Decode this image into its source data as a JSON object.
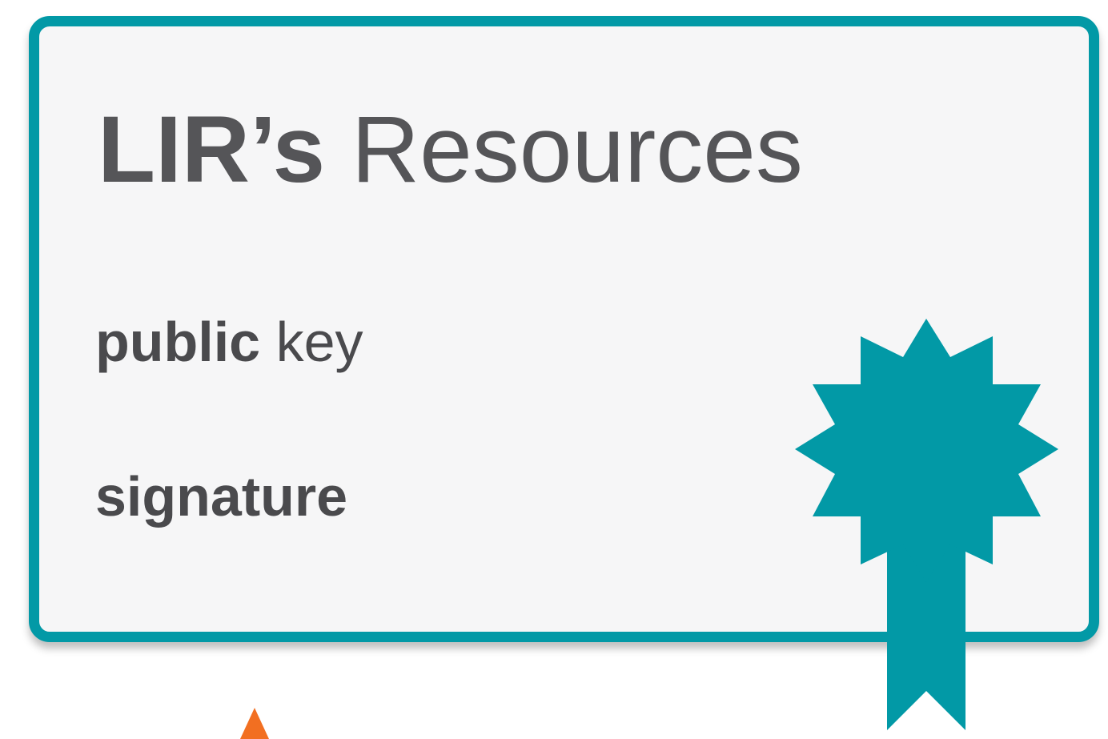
{
  "certificate": {
    "title_bold": "LIR’s",
    "title_regular": "Resources",
    "key_bold": "public",
    "key_regular": "key",
    "signature": "signature"
  },
  "colors": {
    "teal": "#0299a6",
    "card_bg": "#f6f6f7",
    "text": "#555558",
    "arrow": "#f26f21"
  },
  "icons": {
    "seal": "rosette-ribbon-icon",
    "arrow": "up-triangle-icon"
  }
}
